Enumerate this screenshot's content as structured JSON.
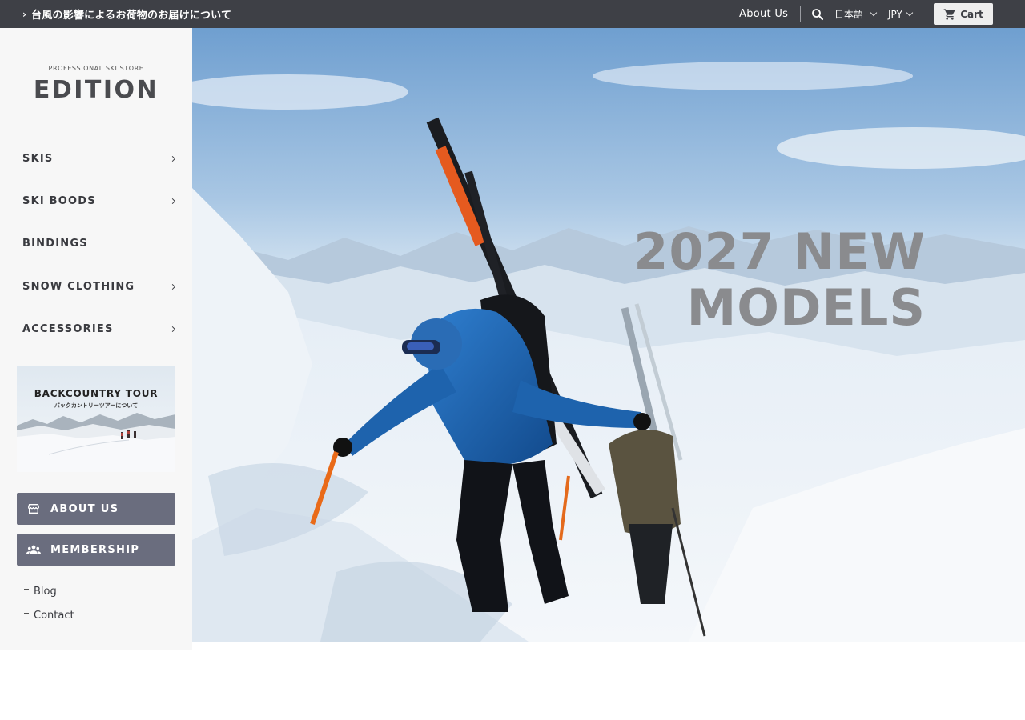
{
  "topbar": {
    "announcement": "台風の影響によるお荷物のお届けについて",
    "about_link": "About Us",
    "language": "日本語",
    "currency": "JPY",
    "cart_label": "Cart"
  },
  "logo": {
    "tagline": "PROFESSIONAL SKI STORE",
    "name": "EDITION"
  },
  "nav": {
    "items": [
      {
        "label": "SKIS",
        "has_submenu": true
      },
      {
        "label": "SKI BOODS",
        "has_submenu": true
      },
      {
        "label": "BINDINGS",
        "has_submenu": false
      },
      {
        "label": "SNOW CLOTHING",
        "has_submenu": true
      },
      {
        "label": "ACCESSORIES",
        "has_submenu": true
      }
    ]
  },
  "banner": {
    "title": "BACKCOUNTRY TOUR",
    "subtitle": "バックカントリーツアーについて"
  },
  "buttons": {
    "about": "ABOUT US",
    "membership": "MEMBERSHIP"
  },
  "links": {
    "blog": "Blog",
    "contact": "Contact"
  },
  "hero": {
    "title_line1": "2027 NEW",
    "title_line2": "MODELS"
  },
  "colors": {
    "topbar": "#3e4046",
    "sidebar": "#f7f7f7",
    "button": "#6a6d7e",
    "hero_title": "#8a8b8e"
  }
}
